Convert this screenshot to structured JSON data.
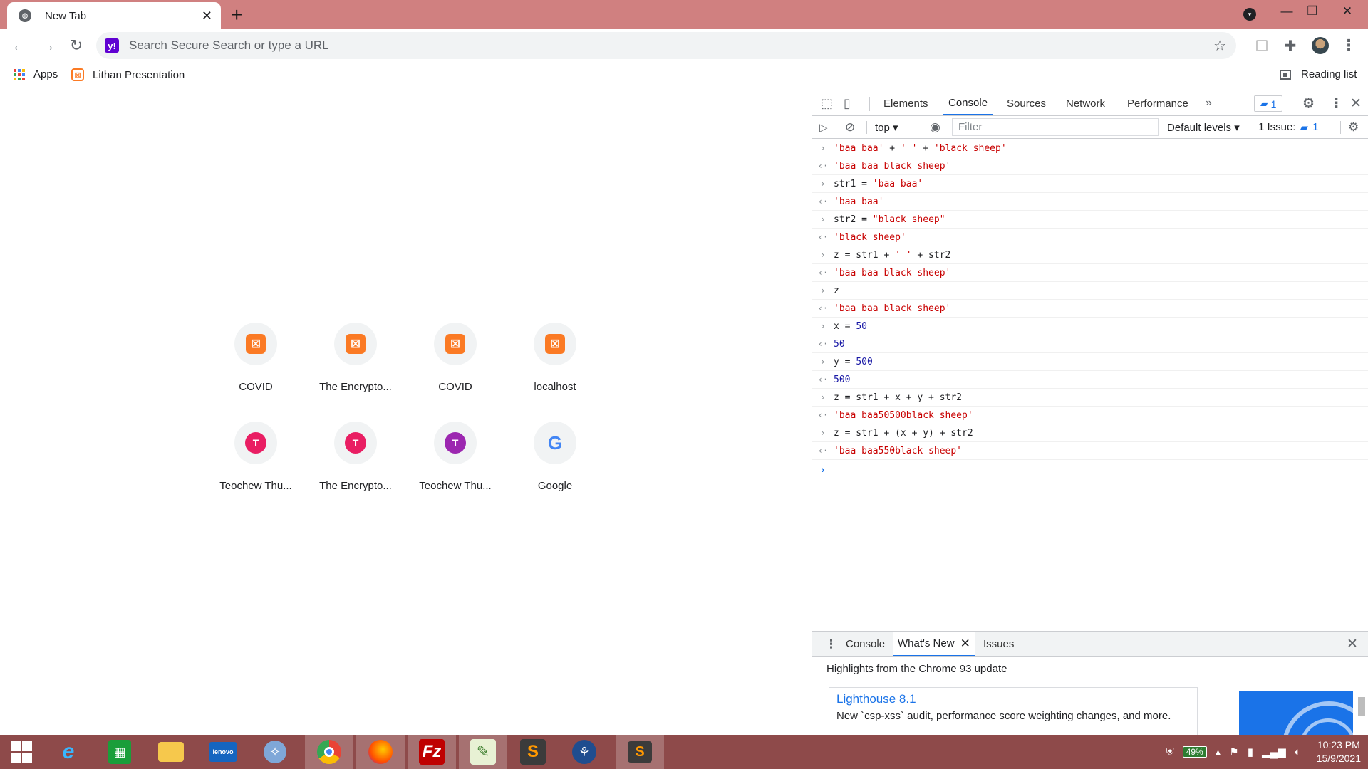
{
  "browser": {
    "tab": {
      "title": "New Tab",
      "close": "✕"
    },
    "new_tab": "+",
    "window_controls": {
      "minimize": "—",
      "maximize": "❐",
      "close": "✕"
    },
    "omnibox": {
      "placeholder": "Search Secure Search or type a URL",
      "engine_icon": "y!"
    },
    "bookmarks": [
      {
        "label": "Apps"
      },
      {
        "label": "Lithan Presentation"
      }
    ],
    "reading_list": "Reading list"
  },
  "ntp": {
    "shortcuts": [
      {
        "label": "COVID",
        "icon": "xampp"
      },
      {
        "label": "The Encrypto...",
        "icon": "xampp"
      },
      {
        "label": "COVID",
        "icon": "xampp"
      },
      {
        "label": "localhost",
        "icon": "xampp"
      },
      {
        "label": "Teochew Thu...",
        "icon": "T",
        "color": "#e91e63"
      },
      {
        "label": "The Encrypto...",
        "icon": "T",
        "color": "#e91e63"
      },
      {
        "label": "Teochew Thu...",
        "icon": "T",
        "color": "#9c27b0"
      },
      {
        "label": "Google",
        "icon": "G"
      }
    ]
  },
  "devtools": {
    "tabs": [
      "Elements",
      "Console",
      "Sources",
      "Network",
      "Performance"
    ],
    "active_tab": "Console",
    "more_tabs": "»",
    "issues_badge": "1",
    "filterbar": {
      "context": "top ▾",
      "filter_placeholder": "Filter",
      "levels": "Default levels ▾",
      "issues_label": "1 Issue:",
      "issues_count": "1"
    },
    "console_lines": [
      {
        "type": "in",
        "text": "'baa baa' + ' ' + 'black sheep'"
      },
      {
        "type": "out",
        "kind": "str",
        "text": "'baa baa black sheep'"
      },
      {
        "type": "in",
        "text": "str1 = 'baa baa'"
      },
      {
        "type": "out",
        "kind": "str",
        "text": "'baa baa'"
      },
      {
        "type": "in",
        "text": "str2 = \"black sheep\""
      },
      {
        "type": "out",
        "kind": "str",
        "text": "'black sheep'"
      },
      {
        "type": "in",
        "text": "z = str1 + ' ' + str2"
      },
      {
        "type": "out",
        "kind": "str",
        "text": "'baa baa black sheep'"
      },
      {
        "type": "in",
        "text": "z"
      },
      {
        "type": "out",
        "kind": "str",
        "text": "'baa baa black sheep'"
      },
      {
        "type": "in",
        "text": "x = 50"
      },
      {
        "type": "out",
        "kind": "num",
        "text": "50"
      },
      {
        "type": "in",
        "text": "y = 500"
      },
      {
        "type": "out",
        "kind": "num",
        "text": "500"
      },
      {
        "type": "in",
        "text": "z = str1 + x + y + str2"
      },
      {
        "type": "out",
        "kind": "str",
        "text": "'baa baa50500black sheep'"
      },
      {
        "type": "in",
        "text": "z = str1 + (x + y) + str2"
      },
      {
        "type": "out",
        "kind": "str",
        "text": "'baa baa550black sheep'"
      }
    ],
    "drawer": {
      "tabs": [
        "Console",
        "What's New",
        "Issues"
      ],
      "active_tab": "What's New",
      "highlights": "Highlights from the Chrome 93 update",
      "news_title": "Lighthouse 8.1",
      "news_desc": "New `csp-xss` audit, performance score weighting changes, and more."
    }
  },
  "taskbar": {
    "apps": [
      "start",
      "internet-explorer",
      "store",
      "file-explorer",
      "lenovo",
      "safari",
      "chrome",
      "firefox",
      "filezilla",
      "notepad",
      "sublime-text",
      "sourcetree",
      "sublime"
    ],
    "battery": "49%",
    "time": "10:23 PM",
    "date": "15/9/2021"
  }
}
